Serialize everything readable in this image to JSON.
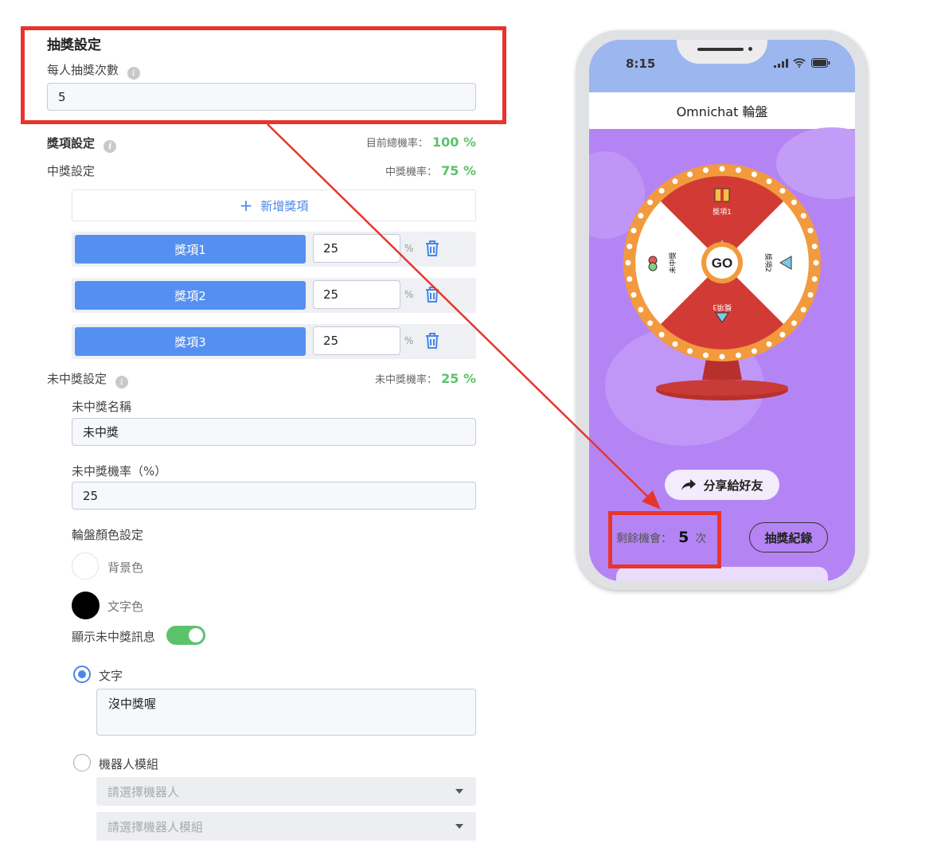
{
  "lottery_settings": {
    "title": "抽獎設定",
    "draws_per_person_label": "每人抽獎次數",
    "draws_per_person_value": "5"
  },
  "prize_settings": {
    "title": "獎項設定",
    "total_rate_label": "目前總機率：",
    "total_rate_value": "100 %",
    "win_title": "中獎設定",
    "win_rate_label": "中獎機率：",
    "win_rate_value": "75 %",
    "add_prize_label": "新增獎項",
    "prizes": [
      {
        "name": "獎項1",
        "value": "25",
        "unit": "%"
      },
      {
        "name": "獎項2",
        "value": "25",
        "unit": "%"
      },
      {
        "name": "獎項3",
        "value": "25",
        "unit": "%"
      }
    ]
  },
  "no_win_settings": {
    "title": "未中獎設定",
    "rate_label": "未中獎機率：",
    "rate_value": "25 %",
    "name_label": "未中獎名稱",
    "name_value": "未中獎",
    "prob_label": "未中獎機率（%）",
    "prob_value": "25"
  },
  "wheel_colors": {
    "title": "輪盤顏色設定",
    "background_label": "背景色",
    "background_color": "#ffffff",
    "text_label": "文字色",
    "text_color": "#000000"
  },
  "show_message": {
    "label": "顯示未中獎訊息",
    "enabled": true,
    "option_text_label": "文字",
    "text_value": "沒中獎喔",
    "option_bot_label": "機器人模組",
    "select_bot_placeholder": "請選擇機器人",
    "select_module_placeholder": "請選擇機器人模組"
  },
  "phone": {
    "time": "8:15",
    "app_title": "Omnichat 輪盤",
    "go_label": "GO",
    "wheel_segments": [
      "獎項1",
      "獎項2",
      "獎項3",
      "未中獎"
    ],
    "share_label": "分享給好友",
    "remaining_label": "剩餘機會：",
    "remaining_value": "5",
    "remaining_unit": "次",
    "history_label": "抽獎紀錄"
  },
  "colors": {
    "accent_blue": "#5590f0",
    "rate_green": "#5cc26b",
    "highlight_red": "#e8352b",
    "wheel_red": "#d23b35",
    "wheel_orange": "#f29a3d",
    "phone_purple": "#b584f4"
  }
}
